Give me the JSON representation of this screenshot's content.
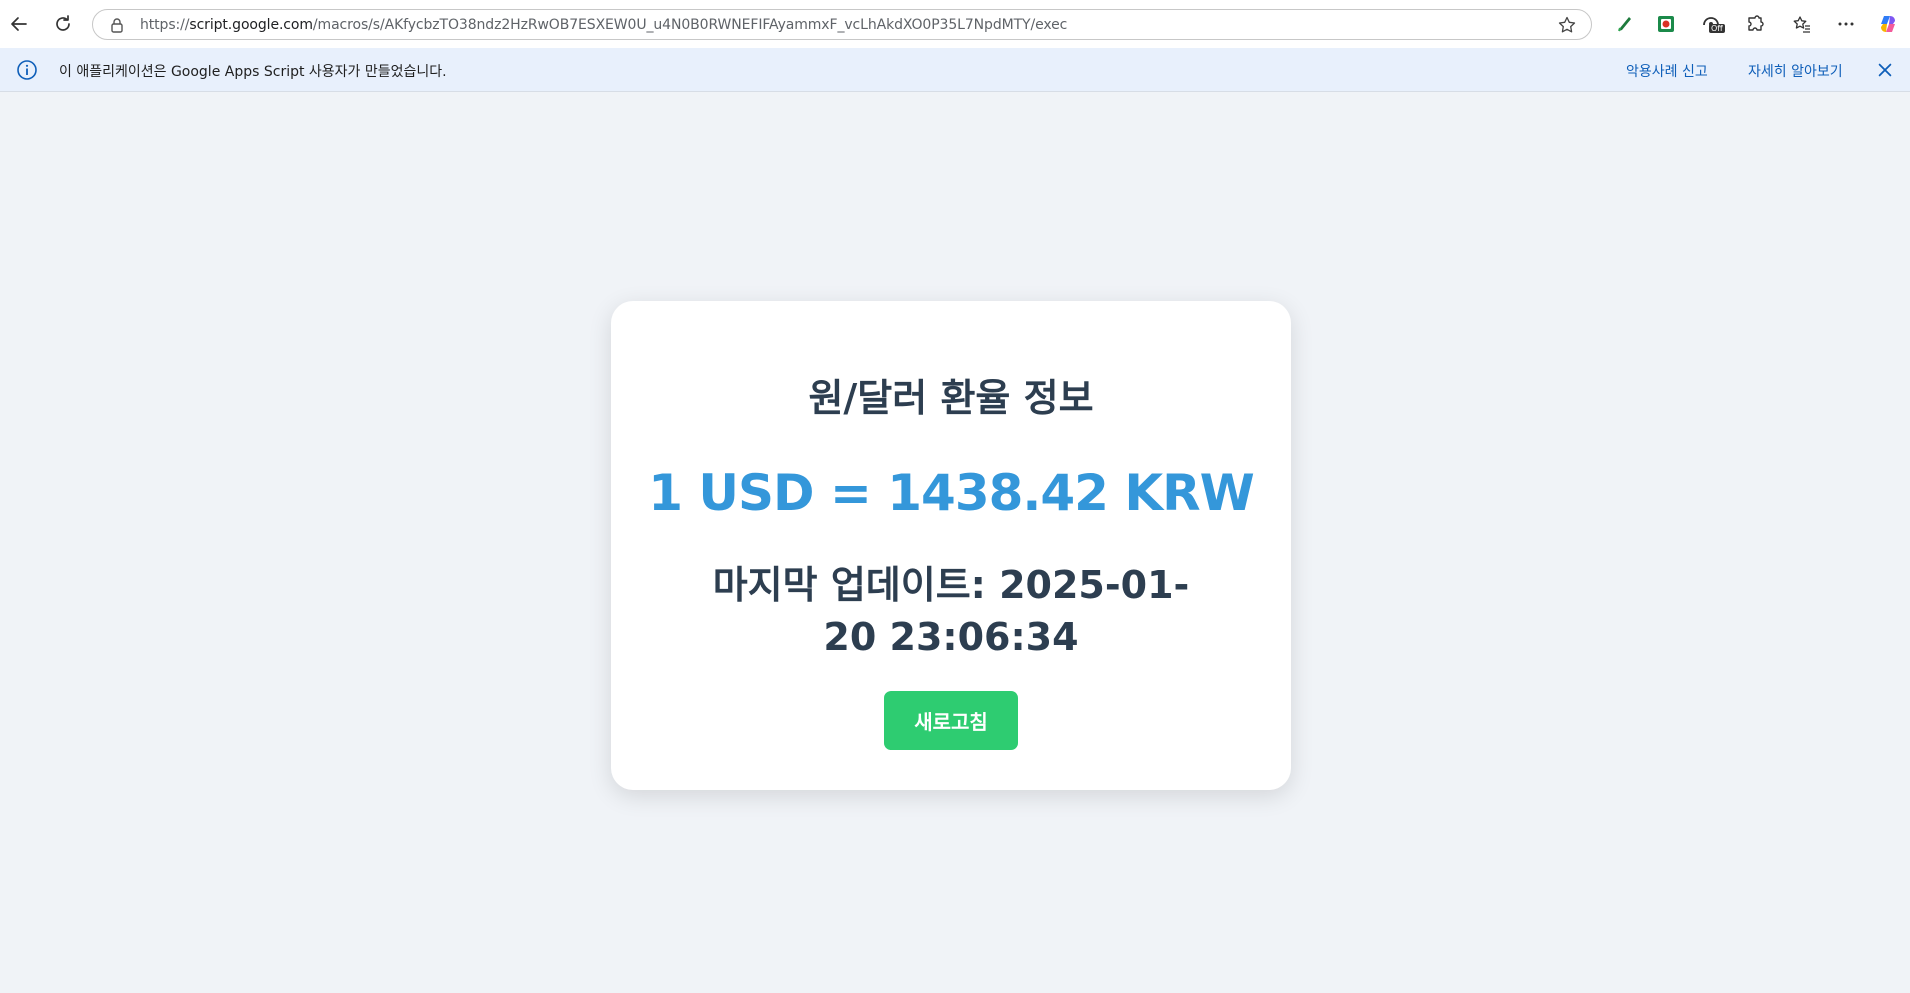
{
  "browser": {
    "url_prefix": "https://",
    "url_host": "script.google.com",
    "url_path": "/macros/s/AKfycbzTO38ndz2HzRwOB7ESXEW0U_u4N0B0RWNEFIFAyammxF_vcLhAkdXO0P35L7NpdMTY/exec",
    "icons": [
      "back-icon",
      "reload-icon",
      "lock-icon",
      "favorite-star-icon",
      "pen-extension-icon",
      "record-extension-icon",
      "off-extension-icon",
      "extensions-icon",
      "favorites-list-icon",
      "more-icon",
      "copilot-icon"
    ],
    "off_badge": "Off"
  },
  "infobar": {
    "message": "이 애플리케이션은 Google Apps Script 사용자가 만들었습니다.",
    "report_link": "악용사례 신고",
    "learn_more_link": "자세히 알아보기"
  },
  "card": {
    "title": "원/달러 환율 정보",
    "rate": "1 USD = 1438.42 KRW",
    "updated": "마지막 업데이트: 2025-01-20 23:06:34",
    "refresh_label": "새로고침"
  },
  "colors": {
    "page_bg": "#f0f3f7",
    "infobar_bg": "#e8f0fc",
    "title": "#2d3e50",
    "rate": "#3497da",
    "button": "#2ecc71",
    "link": "#0f5fb9"
  }
}
